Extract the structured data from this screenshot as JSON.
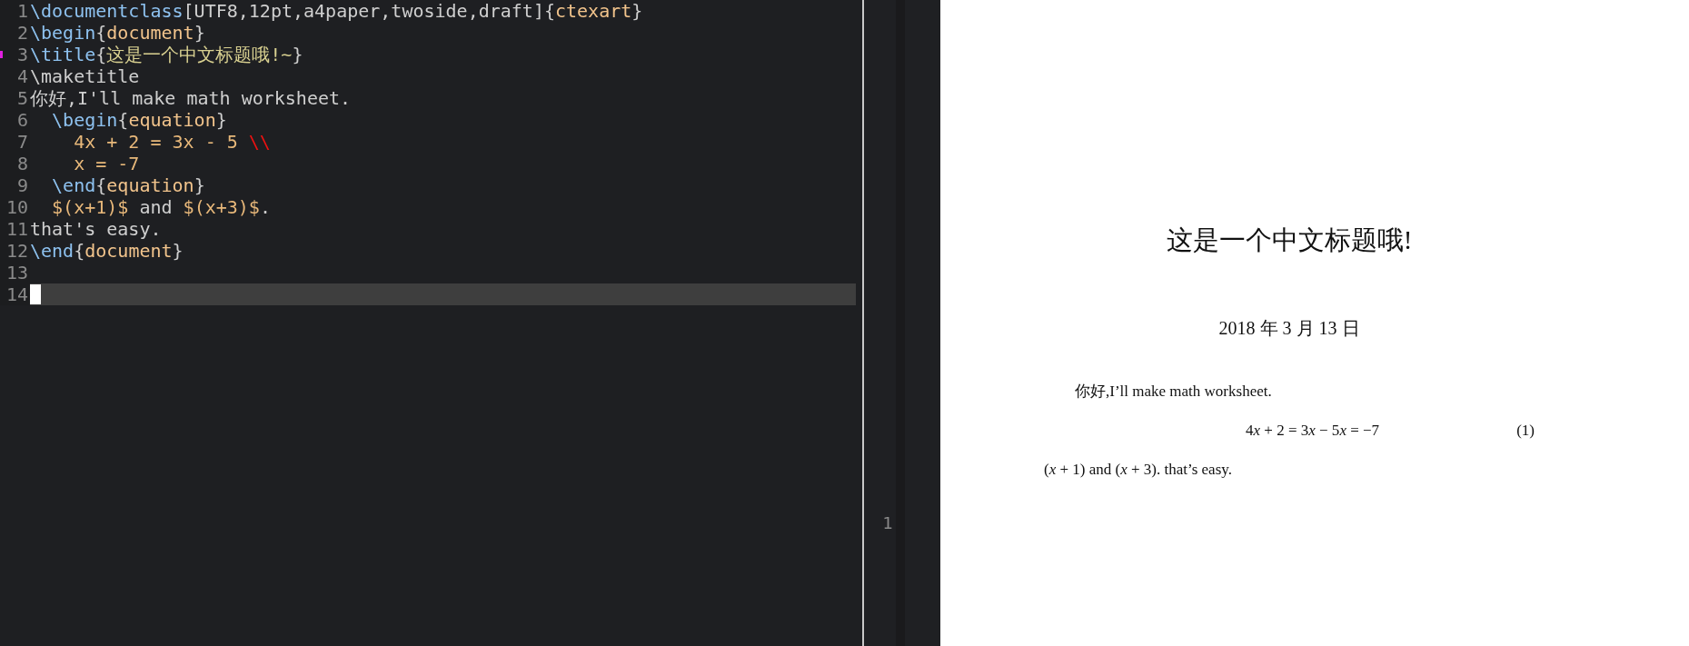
{
  "editor": {
    "lines": [
      {
        "number": "1",
        "marked": false,
        "current": false,
        "segments": [
          {
            "kind": "command",
            "text": "\\documentclass"
          },
          {
            "kind": "text",
            "text": "[UTF8,12pt,a4paper,twoside,draft]{"
          },
          {
            "kind": "argument",
            "text": "ctexart"
          },
          {
            "kind": "text",
            "text": "}"
          }
        ]
      },
      {
        "number": "2",
        "marked": false,
        "current": false,
        "segments": [
          {
            "kind": "command",
            "text": "\\begin"
          },
          {
            "kind": "text",
            "text": "{"
          },
          {
            "kind": "argument",
            "text": "document"
          },
          {
            "kind": "text",
            "text": "}"
          }
        ]
      },
      {
        "number": "3",
        "marked": true,
        "current": false,
        "segments": [
          {
            "kind": "command",
            "text": "\\title"
          },
          {
            "kind": "text",
            "text": "{"
          },
          {
            "kind": "title",
            "text": "这是一个中文标题哦!~"
          },
          {
            "kind": "text",
            "text": "}"
          }
        ]
      },
      {
        "number": "4",
        "marked": false,
        "current": false,
        "segments": [
          {
            "kind": "text",
            "text": "\\maketitle"
          }
        ]
      },
      {
        "number": "5",
        "marked": false,
        "current": false,
        "segments": [
          {
            "kind": "text",
            "text": "你好,I'll make math worksheet."
          }
        ]
      },
      {
        "number": "6",
        "marked": false,
        "current": false,
        "segments": [
          {
            "kind": "command",
            "text": "  \\begin"
          },
          {
            "kind": "text",
            "text": "{"
          },
          {
            "kind": "argument",
            "text": "equation"
          },
          {
            "kind": "text",
            "text": "}"
          }
        ]
      },
      {
        "number": "7",
        "marked": false,
        "current": false,
        "segments": [
          {
            "kind": "math",
            "text": "    4x + 2 = 3x - 5 "
          },
          {
            "kind": "linebreak",
            "text": "\\\\"
          }
        ]
      },
      {
        "number": "8",
        "marked": false,
        "current": false,
        "segments": [
          {
            "kind": "math",
            "text": "    x = -7"
          }
        ]
      },
      {
        "number": "9",
        "marked": false,
        "current": false,
        "segments": [
          {
            "kind": "command",
            "text": "  \\end"
          },
          {
            "kind": "text",
            "text": "{"
          },
          {
            "kind": "argument",
            "text": "equation"
          },
          {
            "kind": "text",
            "text": "}"
          }
        ]
      },
      {
        "number": "10",
        "marked": false,
        "current": false,
        "segments": [
          {
            "kind": "math",
            "text": "  $(x+1)$"
          },
          {
            "kind": "text",
            "text": " and "
          },
          {
            "kind": "math",
            "text": "$(x+3)$"
          },
          {
            "kind": "text",
            "text": "."
          }
        ]
      },
      {
        "number": "11",
        "marked": false,
        "current": false,
        "segments": [
          {
            "kind": "text",
            "text": "that's easy."
          }
        ]
      },
      {
        "number": "12",
        "marked": false,
        "current": false,
        "segments": [
          {
            "kind": "command",
            "text": "\\end"
          },
          {
            "kind": "text",
            "text": "{"
          },
          {
            "kind": "argument",
            "text": "document"
          },
          {
            "kind": "text",
            "text": "}"
          }
        ]
      },
      {
        "number": "13",
        "marked": false,
        "current": false
      },
      {
        "number": "14",
        "marked": false,
        "current": true
      }
    ]
  },
  "preview_gutter": {
    "line_number": "1"
  },
  "pdf": {
    "title": "这是一个中文标题哦!",
    "date": "2018 年 3 月 13 日",
    "paragraph": "你好,I’ll make math worksheet.",
    "equation": [
      {
        "kind": "number",
        "text": "4"
      },
      {
        "kind": "variable",
        "text": "x"
      },
      {
        "kind": "number",
        "text": " + 2 = 3"
      },
      {
        "kind": "variable",
        "text": "x"
      },
      {
        "kind": "number",
        "text": " − 5"
      },
      {
        "kind": "variable",
        "text": "x"
      },
      {
        "kind": "number",
        "text": " = −7"
      }
    ],
    "equation_number": "(1)",
    "last_line": "(*x* + 1) and (*x* + 3). that’s easy."
  }
}
